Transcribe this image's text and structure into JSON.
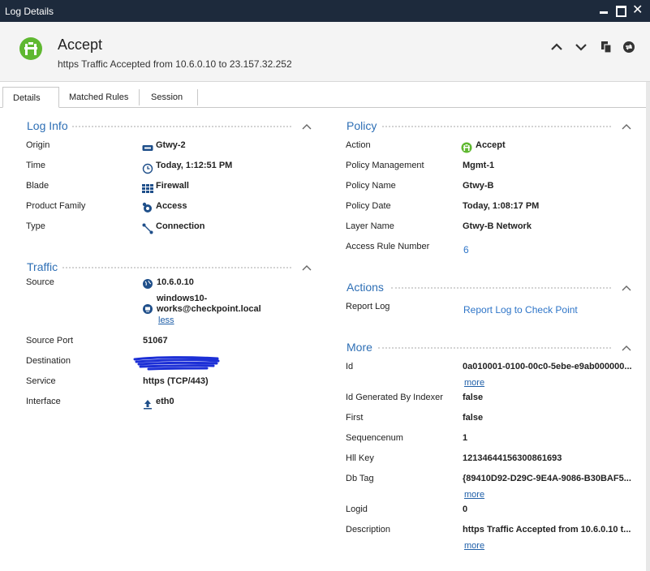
{
  "window": {
    "title": "Log Details"
  },
  "header": {
    "title": "Accept",
    "subtitle": "https Traffic Accepted from 10.6.0.10 to 23.157.32.252",
    "icon": "accept-firewall-icon",
    "accent": "#5fb830"
  },
  "tabs": [
    {
      "label": "Details"
    },
    {
      "label": "Matched Rules"
    },
    {
      "label": "Session"
    }
  ],
  "log_info": {
    "title": "Log Info",
    "rows": [
      {
        "label": "Origin",
        "value": "Gtwy-2",
        "icon": "gateway-icon"
      },
      {
        "label": "Time",
        "value": "Today, 1:12:51 PM",
        "icon": "clock-icon"
      },
      {
        "label": "Blade",
        "value": "Firewall",
        "icon": "firewall-icon"
      },
      {
        "label": "Product Family",
        "value": "Access",
        "icon": "access-icon"
      },
      {
        "label": "Type",
        "value": "Connection",
        "icon": "connection-icon"
      }
    ]
  },
  "traffic": {
    "title": "Traffic",
    "source_label": "Source",
    "source_ip": "10.6.0.10",
    "source_user_line1": "windows10-",
    "source_user_line2": "works@checkpoint.local",
    "less": "less",
    "rows": [
      {
        "label": "Source Port",
        "value": "51067"
      },
      {
        "label": "Destination",
        "value": ""
      },
      {
        "label": "Service",
        "value": "https (TCP/443)"
      },
      {
        "label": "Interface",
        "value": "eth0",
        "icon": "interface-arrow-icon"
      }
    ]
  },
  "policy": {
    "title": "Policy",
    "rows": [
      {
        "label": "Action",
        "value": "Accept",
        "icon": "accept-icon"
      },
      {
        "label": "Policy Management",
        "value": "Mgmt-1"
      },
      {
        "label": "Policy Name",
        "value": "Gtwy-B"
      },
      {
        "label": "Policy Date",
        "value": "Today, 1:08:17 PM"
      },
      {
        "label": "Layer Name",
        "value": "Gtwy-B Network"
      },
      {
        "label": "Access Rule Number",
        "value": "6"
      }
    ]
  },
  "actions": {
    "title": "Actions",
    "label": "Report Log",
    "link": "Report Log to Check Point"
  },
  "more": {
    "title": "More",
    "more_link": "more",
    "rows": [
      {
        "label": "Id",
        "value": "0a010001-0100-00c0-5ebe-e9ab000000..."
      },
      {
        "label": "Id Generated By Indexer",
        "value": "false"
      },
      {
        "label": "First",
        "value": "false"
      },
      {
        "label": "Sequencenum",
        "value": "1"
      },
      {
        "label": "Hll Key",
        "value": "12134644156300861693"
      },
      {
        "label": "Db Tag",
        "value": "{89410D92-D29C-9E4A-9086-B30BAF5..."
      },
      {
        "label": "Logid",
        "value": "0"
      },
      {
        "label": "Description",
        "value": "https Traffic Accepted from 10.6.0.10 t..."
      }
    ]
  }
}
